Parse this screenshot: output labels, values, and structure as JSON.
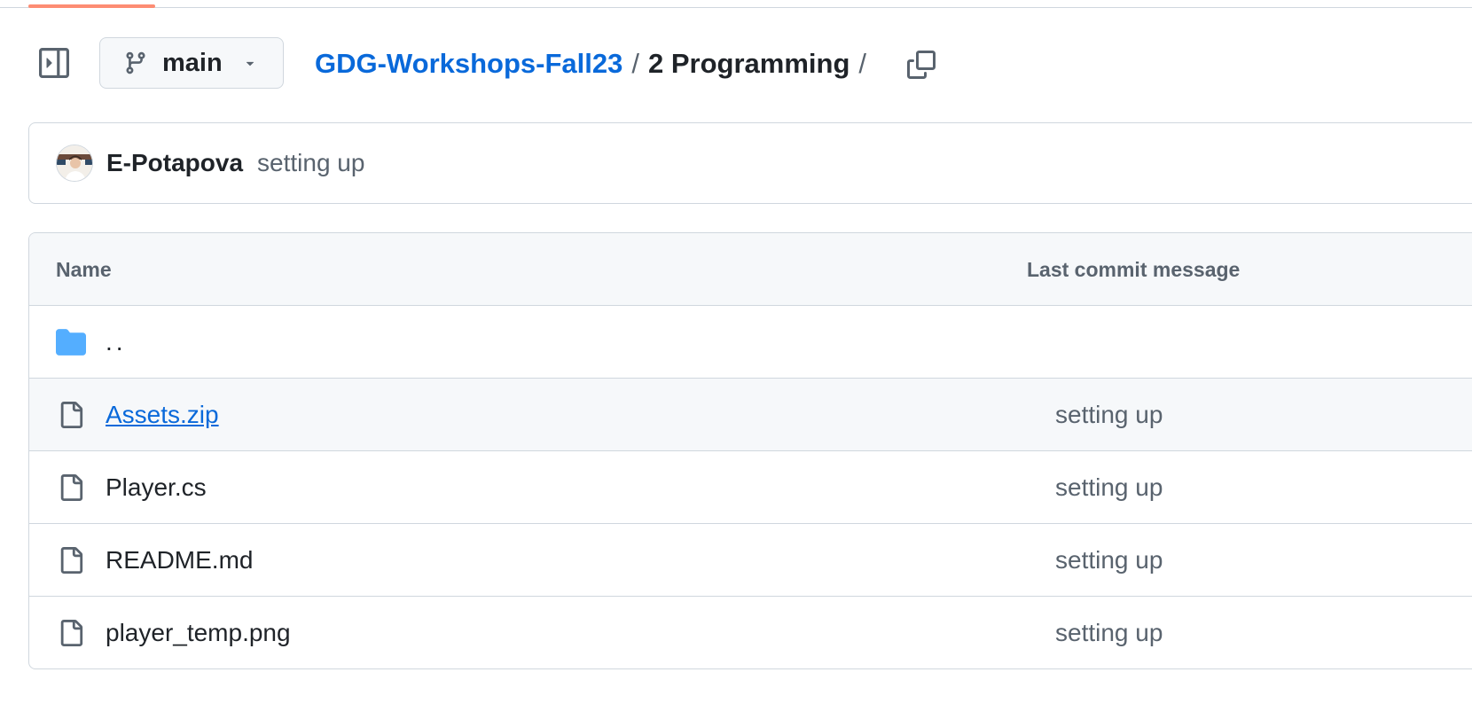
{
  "header": {
    "branch": "main",
    "breadcrumb": {
      "repo": "GDG-Workshops-Fall23",
      "separator": "/",
      "current": "2 Programming",
      "trailing_separator": "/"
    }
  },
  "latest_commit": {
    "author": "E-Potapova",
    "message": "setting up"
  },
  "table": {
    "columns": [
      "Name",
      "Last commit message"
    ],
    "parent_link": "..",
    "rows": [
      {
        "name": "Assets.zip",
        "message": "setting up",
        "icon": "file-icon"
      },
      {
        "name": "Player.cs",
        "message": "setting up",
        "icon": "file-icon"
      },
      {
        "name": "README.md",
        "message": "setting up",
        "icon": "file-icon"
      },
      {
        "name": "player_temp.png",
        "message": "setting up",
        "icon": "file-icon"
      }
    ]
  },
  "colors": {
    "link": "#0969da",
    "muted": "#59636e",
    "border": "#d0d7de",
    "folder": "#54aeff",
    "progress": "#fd8c73"
  },
  "page_load_progress": 0.086
}
